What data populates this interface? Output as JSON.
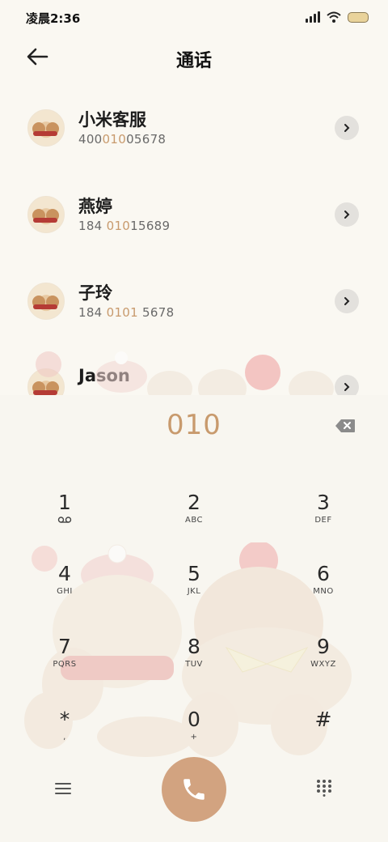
{
  "status_bar": {
    "time": "凌晨2:36",
    "battery_color": "#e9d39b"
  },
  "header": {
    "title": "通话",
    "back_icon": "arrow-left-icon"
  },
  "contacts": [
    {
      "name": "小米客服",
      "number_pre": "400",
      "number_match": "010",
      "number_post": "05678"
    },
    {
      "name": "燕婷",
      "number_pre": "184 ",
      "number_match": "010",
      "number_post": "15689"
    },
    {
      "name": "子玲",
      "number_pre": "184 ",
      "number_match": "0101",
      "number_post": " 5678"
    },
    {
      "name": "Jason",
      "number_pre": "",
      "number_match": "",
      "number_post": ""
    }
  ],
  "dialer": {
    "input": "010",
    "keys": [
      {
        "digit": "1",
        "letters": ""
      },
      {
        "digit": "2",
        "letters": "ABC"
      },
      {
        "digit": "3",
        "letters": "DEF"
      },
      {
        "digit": "4",
        "letters": "GHI"
      },
      {
        "digit": "5",
        "letters": "JKL"
      },
      {
        "digit": "6",
        "letters": "MNO"
      },
      {
        "digit": "7",
        "letters": "PQRS"
      },
      {
        "digit": "8",
        "letters": "TUV"
      },
      {
        "digit": "9",
        "letters": "WXYZ"
      },
      {
        "digit": "*",
        "letters": ","
      },
      {
        "digit": "0",
        "letters": "+"
      },
      {
        "digit": "#",
        "letters": ""
      }
    ]
  },
  "colors": {
    "accent": "#c89a6d",
    "call_button": "#d2a380",
    "background": "#faf8f2"
  },
  "icons": {
    "voicemail": "voicemail-icon",
    "backspace": "backspace-icon",
    "menu": "menu-icon",
    "call": "phone-icon",
    "dialpad": "dialpad-icon",
    "chevron": "chevron-right-icon"
  }
}
